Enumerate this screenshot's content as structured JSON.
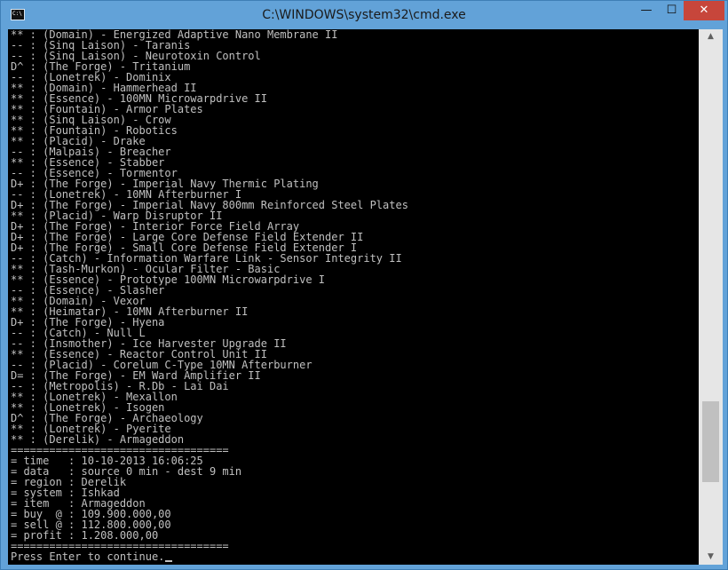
{
  "window": {
    "title": "C:\\WINDOWS\\system32\\cmd.exe",
    "icon_glyph": "C:\\",
    "controls": {
      "minimize": "—",
      "maximize": "☐",
      "close": "✕"
    }
  },
  "console": {
    "lines": [
      "** : (Domain) - Energized Adaptive Nano Membrane II",
      "-- : (Sinq Laison) - Taranis",
      "-- : (Sinq Laison) - Neurotoxin Control",
      "D^ : (The Forge) - Tritanium",
      "-- : (Lonetrek) - Dominix",
      "** : (Domain) - Hammerhead II",
      "** : (Essence) - 100MN Microwarpdrive II",
      "** : (Fountain) - Armor Plates",
      "** : (Sinq Laison) - Crow",
      "** : (Fountain) - Robotics",
      "** : (Placid) - Drake",
      "-- : (Malpais) - Breacher",
      "** : (Essence) - Stabber",
      "-- : (Essence) - Tormentor",
      "D+ : (The Forge) - Imperial Navy Thermic Plating",
      "-- : (Lonetrek) - 10MN Afterburner I",
      "D+ : (The Forge) - Imperial Navy 800mm Reinforced Steel Plates",
      "** : (Placid) - Warp Disruptor II",
      "D+ : (The Forge) - Interior Force Field Array",
      "D+ : (The Forge) - Large Core Defense Field Extender II",
      "D+ : (The Forge) - Small Core Defense Field Extender I",
      "-- : (Catch) - Information Warfare Link - Sensor Integrity II",
      "** : (Tash-Murkon) - Ocular Filter - Basic",
      "** : (Essence) - Prototype 100MN Microwarpdrive I",
      "-- : (Essence) - Slasher",
      "** : (Domain) - Vexor",
      "** : (Heimatar) - 10MN Afterburner II",
      "D+ : (The Forge) - Hyena",
      "-- : (Catch) - Null L",
      "-- : (Insmother) - Ice Harvester Upgrade II",
      "** : (Essence) - Reactor Control Unit II",
      "-- : (Placid) - Corelum C-Type 10MN Afterburner",
      "D= : (The Forge) - EM Ward Amplifier II",
      "-- : (Metropolis) - R.Db - Lai Dai",
      "** : (Lonetrek) - Mexallon",
      "** : (Lonetrek) - Isogen",
      "D^ : (The Forge) - Archaeology",
      "** : (Lonetrek) - Pyerite",
      "** : (Derelik) - Armageddon",
      "==================================",
      "= time   : 10-10-2013 16:06:25",
      "= data   : source 0 min - dest 9 min",
      "= region : Derelik",
      "= system : Ishkad",
      "= item   : Armageddon",
      "= buy  @ : 109.900.000,00",
      "= sell @ : 112.800.000,00",
      "= profit : 1.208.000,00",
      "=================================="
    ],
    "prompt": "Press Enter to continue."
  },
  "scrollbar": {
    "up_arrow": "▲",
    "down_arrow": "▼",
    "position_fraction": 0.84,
    "visible_fraction": 0.16
  },
  "colors": {
    "frame": "#62a2d8",
    "console_bg": "#000000",
    "console_fg": "#c0c0c0",
    "close_button": "#c7463b"
  }
}
